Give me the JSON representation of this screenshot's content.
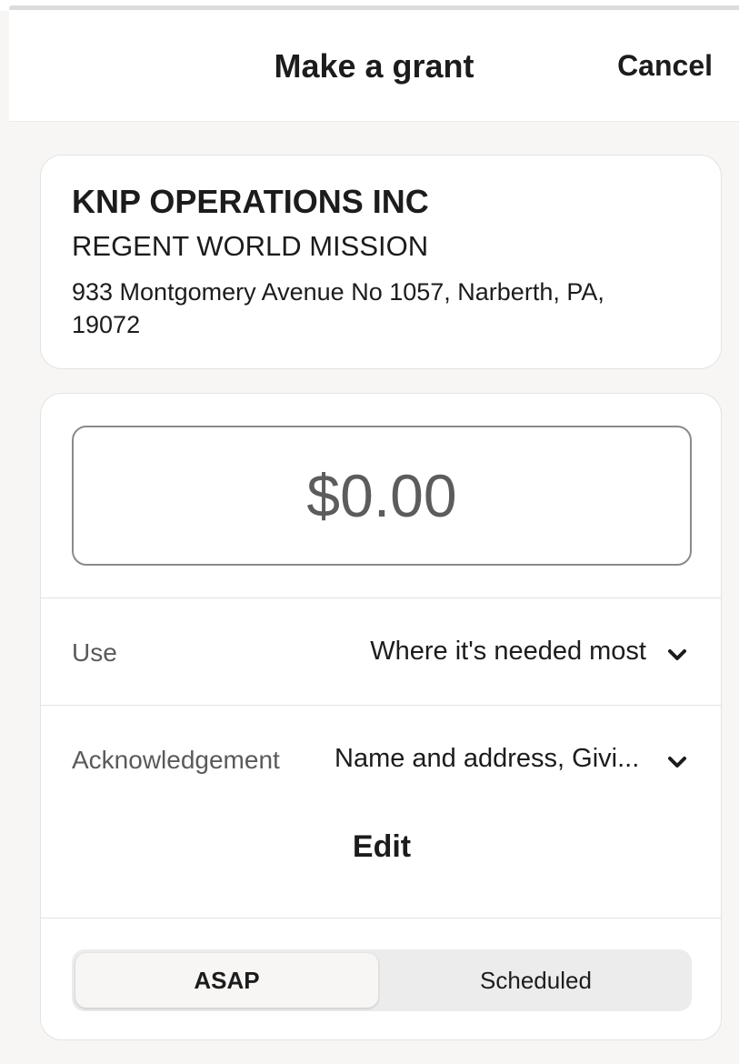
{
  "header": {
    "title": "Make a grant",
    "cancel_label": "Cancel"
  },
  "organization": {
    "name": "KNP OPERATIONS INC",
    "program": "REGENT WORLD MISSION",
    "address": "933 Montgomery Avenue No 1057, Narberth, PA, 19072"
  },
  "grant": {
    "amount": "$0.00",
    "use": {
      "label": "Use",
      "value": "Where it's needed most",
      "icon": "chevron-down-icon"
    },
    "acknowledgement": {
      "label": "Acknowledgement",
      "value": "Name and address, Givi...",
      "icon": "chevron-down-icon"
    },
    "edit_label": "Edit",
    "timing": {
      "options": [
        "ASAP",
        "Scheduled"
      ],
      "selected": "ASAP"
    }
  },
  "colors": {
    "background": "#f7f6f4",
    "card": "#ffffff",
    "text": "#1c1c1c",
    "muted_text": "#5a5a5a",
    "border": "#e3e3e3",
    "segment_track": "#ececec"
  }
}
